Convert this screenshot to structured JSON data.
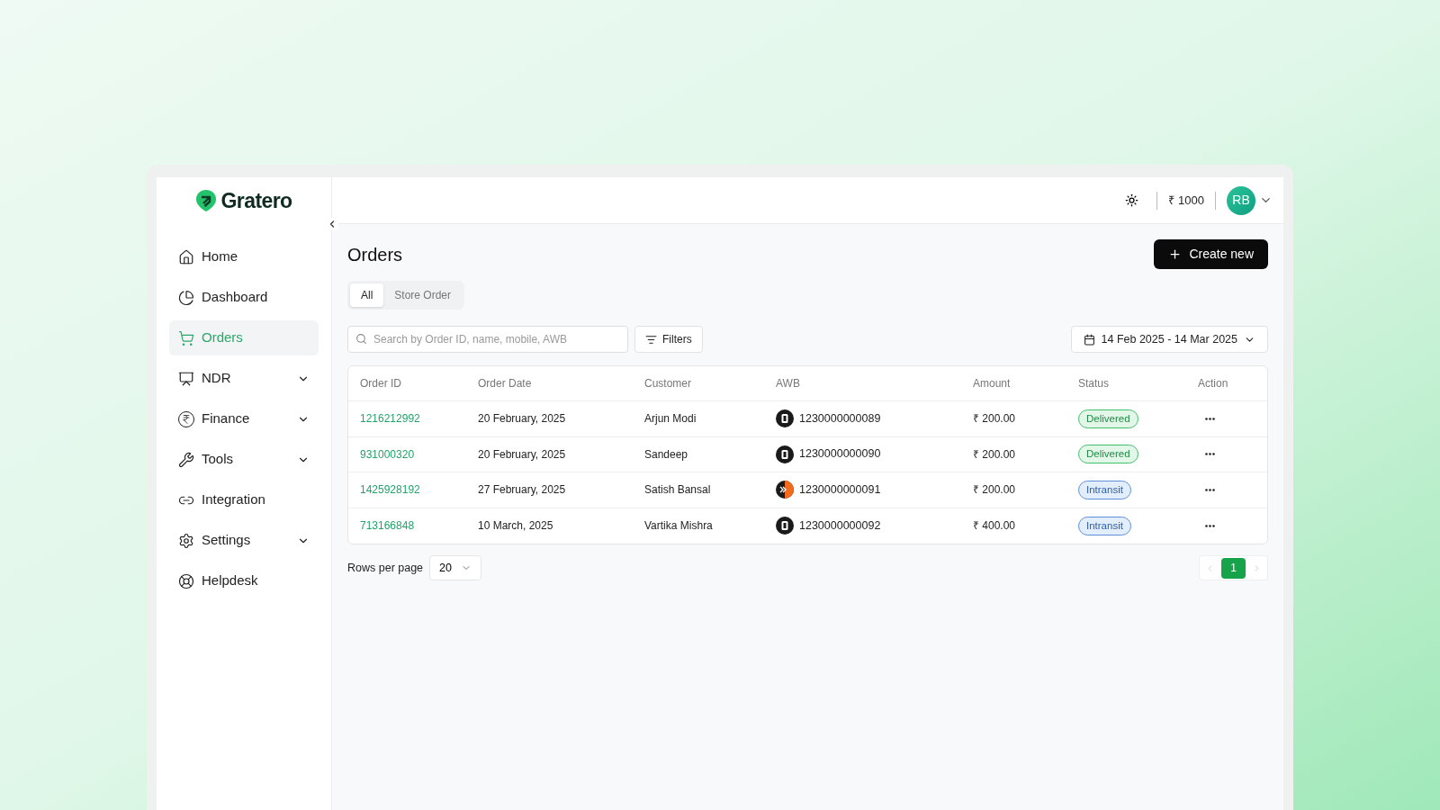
{
  "brand": {
    "name": "Gratero"
  },
  "sidebar": {
    "items": [
      {
        "label": "Home",
        "kind": "home",
        "selected": false,
        "expandable": false
      },
      {
        "label": "Dashboard",
        "kind": "dashboard",
        "selected": false,
        "expandable": false
      },
      {
        "label": "Orders",
        "kind": "orders",
        "selected": true,
        "expandable": false
      },
      {
        "label": "NDR",
        "kind": "ndr",
        "selected": false,
        "expandable": true
      },
      {
        "label": "Finance",
        "kind": "finance",
        "selected": false,
        "expandable": true
      },
      {
        "label": "Tools",
        "kind": "tools",
        "selected": false,
        "expandable": true
      },
      {
        "label": "Integration",
        "kind": "integration",
        "selected": false,
        "expandable": false
      },
      {
        "label": "Settings",
        "kind": "settings",
        "selected": false,
        "expandable": true
      },
      {
        "label": "Helpdesk",
        "kind": "helpdesk",
        "selected": false,
        "expandable": false
      }
    ]
  },
  "header": {
    "balance": "₹ 1000",
    "avatar": "RB"
  },
  "page": {
    "title": "Orders",
    "create_button": "Create new"
  },
  "tabs": [
    {
      "label": "All",
      "selected": true
    },
    {
      "label": "Store Order",
      "selected": false
    }
  ],
  "search": {
    "placeholder": "Search by Order ID, name, mobile, AWB"
  },
  "filters_button": "Filters",
  "date_range": "14 Feb 2025 - 14 Mar 2025",
  "table": {
    "columns": [
      "Order ID",
      "Order Date",
      "Customer",
      "AWB",
      "Amount",
      "Status",
      "Action"
    ],
    "rows": [
      {
        "order_id": "1216212992",
        "date": "20 February, 2025",
        "customer": "Arjun Modi",
        "awb": {
          "kind": "dark",
          "number": "1230000000089"
        },
        "amount": "₹ 200.00",
        "status": {
          "kind": "delivered",
          "label": "Delivered"
        }
      },
      {
        "order_id": "931000320",
        "date": "20 February, 2025",
        "customer": "Sandeep",
        "awb": {
          "kind": "dark",
          "number": "1230000000090"
        },
        "amount": "₹ 200.00",
        "status": {
          "kind": "delivered",
          "label": "Delivered"
        }
      },
      {
        "order_id": "1425928192",
        "date": "27 February, 2025",
        "customer": "Satish Bansal",
        "awb": {
          "kind": "orange",
          "number": "1230000000091"
        },
        "amount": "₹ 200.00",
        "status": {
          "kind": "intransit",
          "label": "Intransit"
        }
      },
      {
        "order_id": "713166848",
        "date": "10 March, 2025",
        "customer": "Vartika Mishra",
        "awb": {
          "kind": "dark",
          "number": "1230000000092"
        },
        "amount": "₹ 400.00",
        "status": {
          "kind": "intransit",
          "label": "Intransit"
        }
      }
    ]
  },
  "pagination": {
    "rows_label": "Rows per page",
    "rows_value": "20",
    "prev_disabled": true,
    "next_disabled": true,
    "pages": [
      {
        "label": "1",
        "selected": true
      }
    ]
  }
}
